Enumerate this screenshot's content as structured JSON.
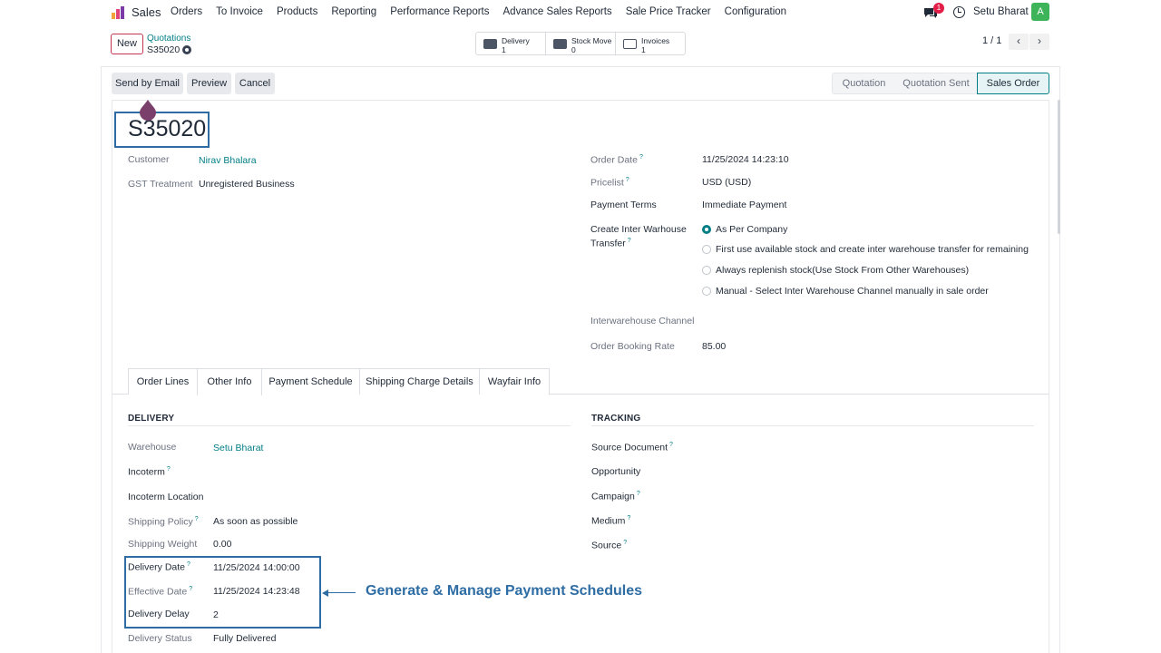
{
  "navbar": {
    "app_name": "Sales",
    "menu": [
      "Orders",
      "To Invoice",
      "Products",
      "Reporting",
      "Performance Reports",
      "Advance Sales Reports",
      "Sale Price Tracker",
      "Configuration"
    ],
    "chat_badge": "1",
    "user_name": "Setu Bharat",
    "avatar_letter": "A",
    "avatar_color": "#3eb45a"
  },
  "control": {
    "new_label": "New",
    "breadcrumb_parent": "Quotations",
    "breadcrumb_current": "S35020",
    "smart_buttons": [
      {
        "label": "Delivery",
        "value": "1",
        "icon": "truck-icon"
      },
      {
        "label": "Stock Move",
        "value": "0",
        "icon": "truck-icon"
      },
      {
        "label": "Invoices",
        "value": "1",
        "icon": "edit-invoice-icon"
      }
    ],
    "pager": "1 / 1"
  },
  "actions": {
    "send_email": "Send by Email",
    "preview": "Preview",
    "cancel": "Cancel"
  },
  "status": {
    "stages": [
      "Quotation",
      "Quotation Sent",
      "Sales Order"
    ],
    "active": "Sales Order"
  },
  "record": {
    "name": "S35020",
    "customer_label": "Customer",
    "customer": "Nirav Bhalara",
    "gst_label": "GST Treatment",
    "gst": "Unregistered Business",
    "order_date_label": "Order Date",
    "order_date": "11/25/2024 14:23:10",
    "pricelist_label": "Pricelist",
    "pricelist": "USD (USD)",
    "payment_terms_label": "Payment Terms",
    "payment_terms": "Immediate Payment",
    "inter_wh_label_1": "Create Inter Warhouse",
    "inter_wh_label_2": "Transfer",
    "inter_wh_options": [
      "As Per Company",
      "First use available stock and create inter warehouse transfer for remaining",
      "Always replenish stock(Use Stock From Other Warehouses)",
      "Manual - Select Inter Warehouse Channel manually in sale order"
    ],
    "inter_wh_channel_label": "Interwarehouse Channel",
    "booking_rate_label": "Order Booking Rate",
    "booking_rate": "85.00"
  },
  "tabs": [
    "Order Lines",
    "Other Info",
    "Payment Schedule",
    "Shipping Charge Details",
    "Wayfair Info"
  ],
  "delivery": {
    "heading": "DELIVERY",
    "warehouse_label": "Warehouse",
    "warehouse": "Setu Bharat",
    "incoterm_label": "Incoterm",
    "incoterm_location_label": "Incoterm Location",
    "shipping_policy_label": "Shipping Policy",
    "shipping_policy": "As soon as possible",
    "shipping_weight_label": "Shipping Weight",
    "shipping_weight": "0.00",
    "delivery_date_label": "Delivery Date",
    "delivery_date": "11/25/2024 14:00:00",
    "effective_date_label": "Effective Date",
    "effective_date": "11/25/2024 14:23:48",
    "delivery_delay_label": "Delivery Delay",
    "delivery_delay": "2",
    "delivery_status_label": "Delivery Status",
    "delivery_status": "Fully Delivered"
  },
  "tracking": {
    "heading": "TRACKING",
    "source_document_label": "Source Document",
    "opportunity_label": "Opportunity",
    "campaign_label": "Campaign",
    "medium_label": "Medium",
    "source_label": "Source"
  },
  "callout": "Generate & Manage Payment Schedules"
}
